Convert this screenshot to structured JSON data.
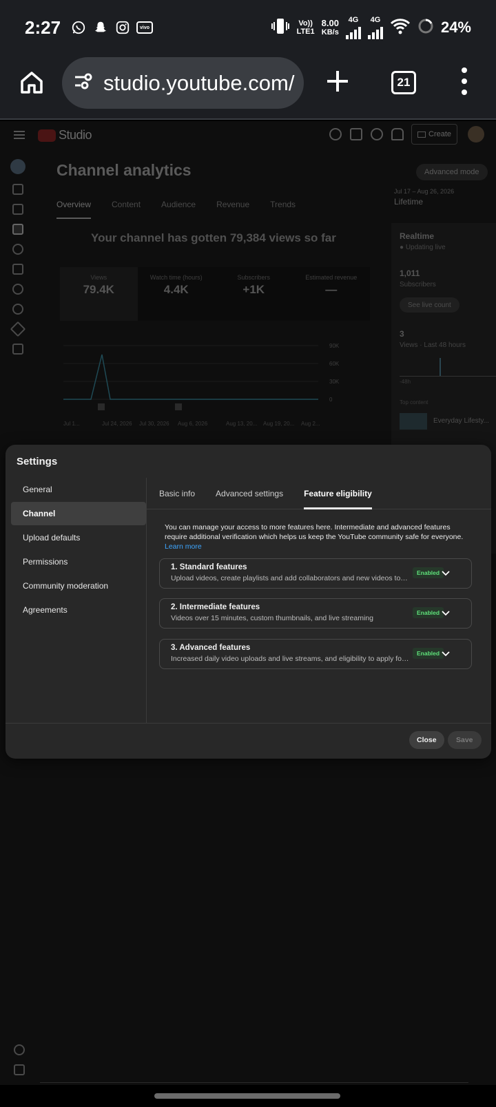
{
  "status_bar": {
    "time": "2:27",
    "apps": [
      "whatsapp-icon",
      "snapchat-icon",
      "instagram-icon",
      "vivo-icon"
    ],
    "vivo_label": "vivo",
    "volte": "Vo))",
    "lte": "LTE1",
    "speed_value": "8.00",
    "speed_unit": "KB/s",
    "net1": "4G",
    "net2": "4G",
    "battery": "24%"
  },
  "browser": {
    "url": "studio.youtube.com/",
    "tab_count": "21"
  },
  "studio": {
    "logo": "Studio",
    "create_label": "Create",
    "page_title": "Channel analytics",
    "advanced_mode": "Advanced mode",
    "date_range": "Jul 17 – Aug 26, 2026",
    "range_label": "Lifetime",
    "tabs": [
      "Overview",
      "Content",
      "Audience",
      "Revenue",
      "Trends"
    ],
    "views_headline": "Your channel has gotten 79,384 views so far",
    "metrics": [
      {
        "label": "Views",
        "value": "79.4K"
      },
      {
        "label": "Watch time (hours)",
        "value": "4.4K"
      },
      {
        "label": "Subscribers",
        "value": "+1K"
      },
      {
        "label": "Estimated revenue",
        "value": "—"
      }
    ],
    "realtime": {
      "title": "Realtime",
      "live": "Updating live",
      "subscribers_value": "1,011",
      "subscribers_label": "Subscribers",
      "see_live": "See live count",
      "views_value": "3",
      "views_label": "Views · Last 48 hours",
      "axis_label": "-48h",
      "top_content": "Top content",
      "top_video": "Everyday Lifesty..."
    }
  },
  "chart_data": {
    "type": "line",
    "x": [
      "Jul 1...",
      "Jul 24, 2026",
      "Jul 30, 2026",
      "Aug 6, 2026",
      "Aug 13, 20...",
      "Aug 19, 20...",
      "Aug 2..."
    ],
    "series": [
      {
        "values": [
          0,
          75000,
          0,
          0,
          0,
          0,
          0
        ]
      }
    ],
    "y_ticks": [
      "90K",
      "60K",
      "30K",
      "0"
    ],
    "ylim": [
      0,
      90000
    ]
  },
  "dialog": {
    "title": "Settings",
    "nav": [
      "General",
      "Channel",
      "Upload defaults",
      "Permissions",
      "Community moderation",
      "Agreements"
    ],
    "active_nav": "Channel",
    "tabs": [
      "Basic info",
      "Advanced settings",
      "Feature eligibility"
    ],
    "active_tab": "Feature eligibility",
    "intro": "You can manage your access to more features here. Intermediate and advanced features require additional verification which helps us keep the YouTube community safe for everyone.",
    "learn_more": "Learn more",
    "features": [
      {
        "title": "1. Standard features",
        "desc": "Upload videos, create playlists and add collaborators and new videos to pla...",
        "status": "Enabled"
      },
      {
        "title": "2. Intermediate features",
        "desc": "Videos over 15 minutes, custom thumbnails, and live streaming",
        "status": "Enabled"
      },
      {
        "title": "3. Advanced features",
        "desc": "Increased daily video uploads and live streams, and eligibility to apply for m...",
        "status": "Enabled"
      }
    ],
    "close_label": "Close",
    "save_label": "Save"
  }
}
